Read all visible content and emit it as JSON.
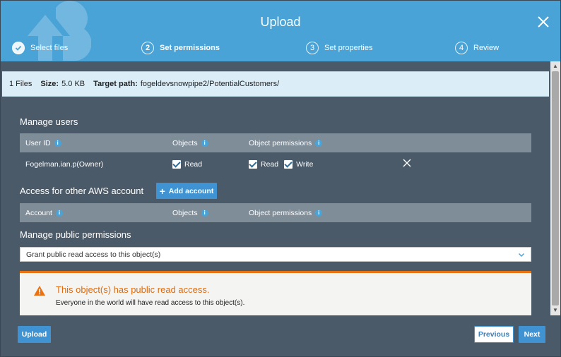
{
  "dialog": {
    "title": "Upload"
  },
  "steps": [
    {
      "number": "",
      "label": "Select files",
      "state": "done"
    },
    {
      "number": "2",
      "label": "Set permissions",
      "state": "active"
    },
    {
      "number": "3",
      "label": "Set properties",
      "state": "pending"
    },
    {
      "number": "4",
      "label": "Review",
      "state": "pending"
    }
  ],
  "summary": {
    "files": "1 Files",
    "size_label": "Size:",
    "size_value": "5.0 KB",
    "path_label": "Target path:",
    "path_value": "fogeldevsnowpipe2/PotentialCustomers/"
  },
  "manage_users": {
    "title": "Manage users",
    "columns": [
      "User ID",
      "Objects",
      "Object permissions"
    ],
    "rows": [
      {
        "user_id": "Fogelman.ian.p(Owner)",
        "objects_read": "Read",
        "perm_read": "Read",
        "perm_write": "Write"
      }
    ]
  },
  "other_accounts": {
    "title": "Access for other AWS account",
    "add_button": "Add account",
    "columns": [
      "Account",
      "Objects",
      "Object permissions"
    ]
  },
  "public_permissions": {
    "title": "Manage public permissions",
    "selected": "Grant public read access to this object(s)"
  },
  "alert": {
    "title": "This object(s) has public read access.",
    "text": "Everyone in the world will have read access to this object(s)."
  },
  "footer": {
    "upload": "Upload",
    "previous": "Previous",
    "next": "Next"
  },
  "colors": {
    "header": "#4aa3d6",
    "body": "#4b5a68",
    "primary": "#3f93d2",
    "warning": "#ec7211"
  }
}
